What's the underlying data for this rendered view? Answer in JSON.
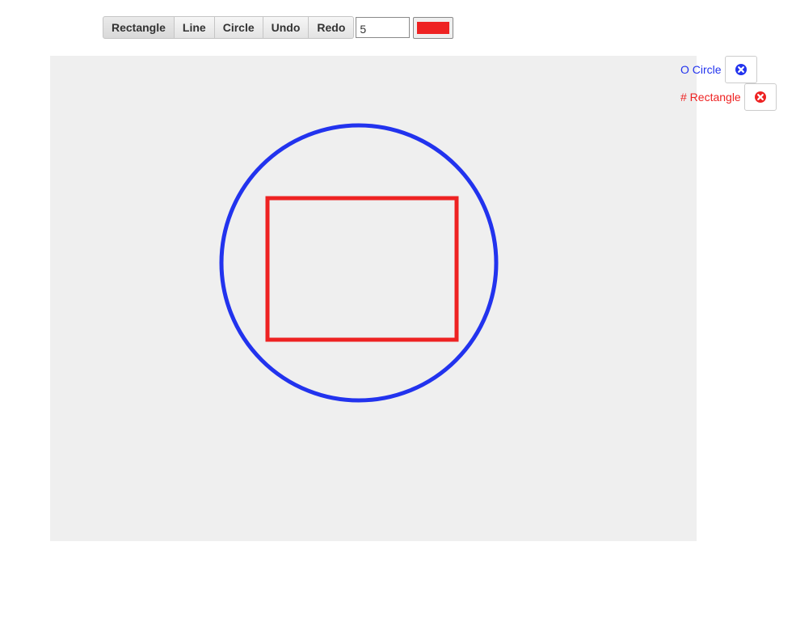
{
  "toolbar": {
    "tools": [
      {
        "label": "Rectangle",
        "active": true
      },
      {
        "label": "Line",
        "active": false
      },
      {
        "label": "Circle",
        "active": false
      },
      {
        "label": "Undo",
        "active": false
      },
      {
        "label": "Redo",
        "active": false
      }
    ],
    "width_value": "5",
    "color_value": "#ee2222"
  },
  "canvas": {
    "background": "#efefef",
    "shapes": [
      {
        "type": "circle",
        "color": "#2233ee"
      },
      {
        "type": "rectangle",
        "color": "#ee2222"
      }
    ]
  },
  "layers": [
    {
      "label": "O Circle",
      "color": "#2233ee",
      "icon": "remove-circle-icon"
    },
    {
      "label": "# Rectangle",
      "color": "#ee2222",
      "icon": "remove-circle-icon"
    }
  ]
}
